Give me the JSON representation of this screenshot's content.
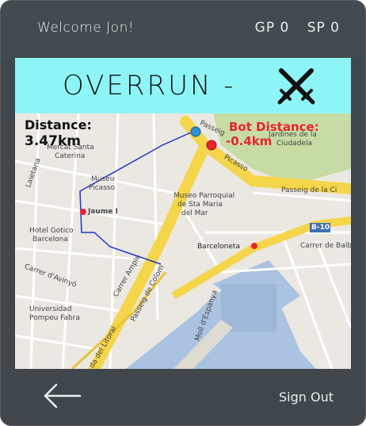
{
  "header": {
    "welcome": "Welcome Jon!",
    "gp": "GP 0",
    "sp": "SP 0"
  },
  "banner": {
    "title": "OVERRUN -",
    "icon": "crossed-swords-icon"
  },
  "map": {
    "distance_label": "Distance:",
    "distance_value": "3.47km",
    "bot_distance_label": "Bot Distance:",
    "bot_distance_value": "-0.4km",
    "player_marker_color": "#2f8fd6",
    "bot_marker_color": "#e8242d",
    "route_color": "#2233cc",
    "labels": {
      "l1": "Mercat Santa",
      "l2": "Caterina",
      "l3": "Museu",
      "l4": "Picasso",
      "l5": "Museo Parroquial",
      "l6": "de Sta Maria",
      "l7": "del Mar",
      "l8": "Jaume I",
      "l9": "Hotel Gotico",
      "l10": "Barcelona",
      "l11": "Barceloneta",
      "l12": "Universidad",
      "l13": "Pompeu Fabra",
      "l14": "Jardines de la",
      "l15": "Ciudadela",
      "l16": "Passeig de la Ci",
      "l17": "Passeig de Colom",
      "l18": "da del Litoral",
      "l19": "Carrer de Balboa",
      "l20": "B-10",
      "l21": "Moll d'Espanya",
      "l22": "Carrer Ample",
      "l23": "Carrer d'Avinyó",
      "l24": "Picasso",
      "l25": "Passeig",
      "l26": "Laietana"
    }
  },
  "footer": {
    "back_icon": "back-arrow-icon",
    "sign_out": "Sign Out"
  }
}
